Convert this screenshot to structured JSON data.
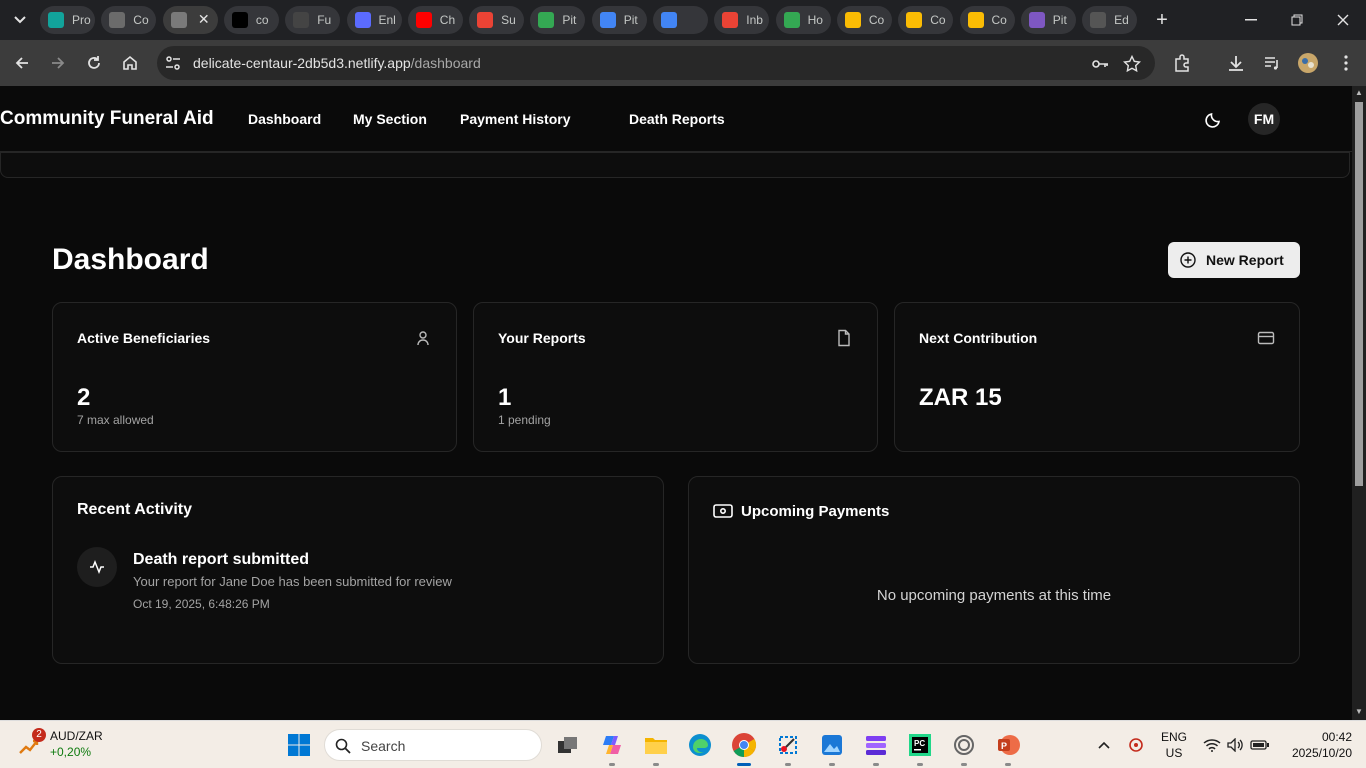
{
  "browser": {
    "tabs": [
      {
        "title": "Pro",
        "color": "#12a39b"
      },
      {
        "title": "Co",
        "color": "#6b6b6b"
      },
      {
        "title": "",
        "color": "#7a7a7a",
        "active": true
      },
      {
        "title": "co",
        "color": "#000000"
      },
      {
        "title": "Fu",
        "color": "#444444"
      },
      {
        "title": "Enl",
        "color": "#5b6bff"
      },
      {
        "title": "Ch",
        "color": "#ff0000"
      },
      {
        "title": "Su",
        "color": "#ea4335"
      },
      {
        "title": "Pit",
        "color": "#34a853"
      },
      {
        "title": "Pit",
        "color": "#4285f4"
      },
      {
        "title": "",
        "color": "#4285f4"
      },
      {
        "title": "Inb",
        "color": "#ea4335"
      },
      {
        "title": "Ho",
        "color": "#34a853"
      },
      {
        "title": "Co",
        "color": "#fbbc04"
      },
      {
        "title": "Co",
        "color": "#fbbc04"
      },
      {
        "title": "Co",
        "color": "#fbbc04"
      },
      {
        "title": "Pit",
        "color": "#7e57c2"
      },
      {
        "title": "Ed",
        "color": "#555555"
      }
    ],
    "url_host": "delicate-centaur-2db5d3.netlify.app",
    "url_path": "/dashboard"
  },
  "nav": {
    "brand": "Community Funeral Aid",
    "links": [
      "Dashboard",
      "My Section",
      "Payment History",
      "Death Reports"
    ],
    "avatar_initials": "FM"
  },
  "main": {
    "title": "Dashboard",
    "new_report_label": "New Report",
    "stats": [
      {
        "title": "Active Beneficiaries",
        "value": "2",
        "sub": "7 max allowed",
        "icon": "user-icon"
      },
      {
        "title": "Your Reports",
        "value": "1",
        "sub": "1 pending",
        "icon": "file-icon"
      },
      {
        "title": "Next Contribution",
        "value": "ZAR 15",
        "sub": "",
        "icon": "credit-card-icon"
      }
    ],
    "recent_activity": {
      "title": "Recent Activity",
      "items": [
        {
          "title": "Death report submitted",
          "desc": "Your report for Jane Doe has been submitted for review",
          "time": "Oct 19, 2025, 6:48:26 PM"
        }
      ]
    },
    "upcoming_payments": {
      "title": "Upcoming Payments",
      "empty": "No upcoming payments at this time"
    }
  },
  "taskbar": {
    "widget_badge": "2",
    "widget_line1": "AUD/ZAR",
    "widget_line2": "+0,20%",
    "search_label": "Search",
    "lang_line1": "ENG",
    "lang_line2": "US",
    "time": "00:42",
    "date": "2025/10/20"
  },
  "colors": {
    "accent": "#005fb8",
    "page_bg": "#0a0a0a",
    "card_border": "#262626"
  }
}
